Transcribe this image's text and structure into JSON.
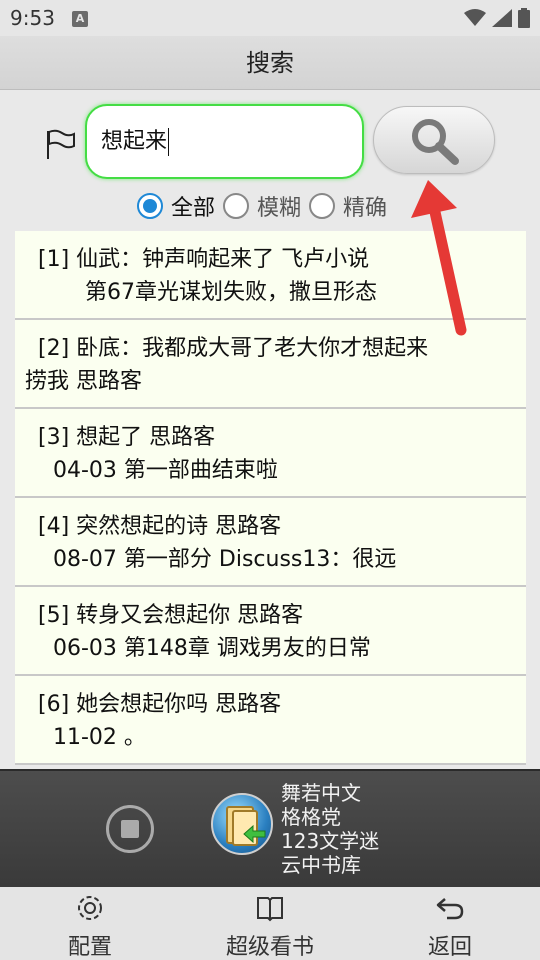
{
  "status": {
    "time": "9:53",
    "notification_letter": "A"
  },
  "header": {
    "title": "搜索"
  },
  "search": {
    "query": "想起来"
  },
  "modes": [
    {
      "label": "全部",
      "selected": true
    },
    {
      "label": "模糊",
      "selected": false
    },
    {
      "label": "精确",
      "selected": false
    }
  ],
  "results": [
    {
      "line1": "[1]  仙武：钟声响起来了  飞卢小说",
      "line2": "第67章光谋划失败，撒旦形态",
      "indent": "large"
    },
    {
      "line1": "[2]  卧底：我都成大哥了老大你才想起来",
      "line2": "捞我  思路客",
      "indent": "none"
    },
    {
      "line1": "[3]  想起了  思路客",
      "line2": "04-03   第一部曲结束啦",
      "indent": "small"
    },
    {
      "line1": "[4]  突然想起的诗  思路客",
      "line2": "08-07   第一部分 Discuss13：很远",
      "indent": "small"
    },
    {
      "line1": "[5]  转身又会想起你  思路客",
      "line2": "06-03   第148章 调戏男友的日常",
      "indent": "small"
    },
    {
      "line1": "[6]  她会想起你吗  思路客",
      "line2": "11-02   。",
      "indent": "small"
    }
  ],
  "player": {
    "lines": [
      "舞若中文",
      "格格党",
      "123文学迷",
      "云中书库"
    ]
  },
  "nav": {
    "settings": "配置",
    "reader": "超级看书",
    "back": "返回"
  },
  "colors": {
    "input_border": "#44dd44",
    "radio_accent": "#1e88d6",
    "result_bg": "#fbfff0",
    "arrow": "#e53935",
    "player_bg": "#444444"
  }
}
